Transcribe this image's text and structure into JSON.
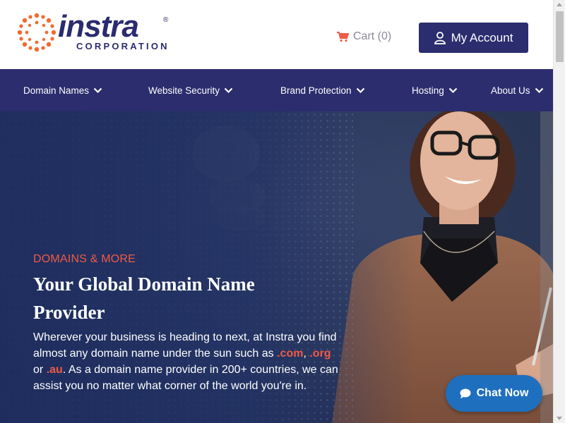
{
  "brand": {
    "name": "instra",
    "registered": "®",
    "subtitle": "CORPORATION",
    "navy": "#2b2d6e",
    "orange": "#f05a44"
  },
  "header": {
    "cart_label": "Cart (0)",
    "account_label": "My Account"
  },
  "nav": {
    "items": [
      {
        "label": "Domain Names"
      },
      {
        "label": "Website Security"
      },
      {
        "label": "Brand Protection"
      },
      {
        "label": "Hosting"
      },
      {
        "label": "About Us"
      }
    ]
  },
  "hero": {
    "kicker": "DOMAINS & MORE",
    "title": "Your Global Domain Name Provider",
    "text_1": "Wherever your business is heading to next, at Instra you find almost any domain name under the sun such as",
    "tld_1": ".com",
    "sep_1": ",",
    "tld_2": ".org",
    "sep_2": "or",
    "tld_3": ".au",
    "text_2": ". As a domain name provider in 200+ countries, we can assist you no matter what corner of the world you're in."
  },
  "chat": {
    "label": "Chat Now",
    "color": "#1f6fbf"
  }
}
